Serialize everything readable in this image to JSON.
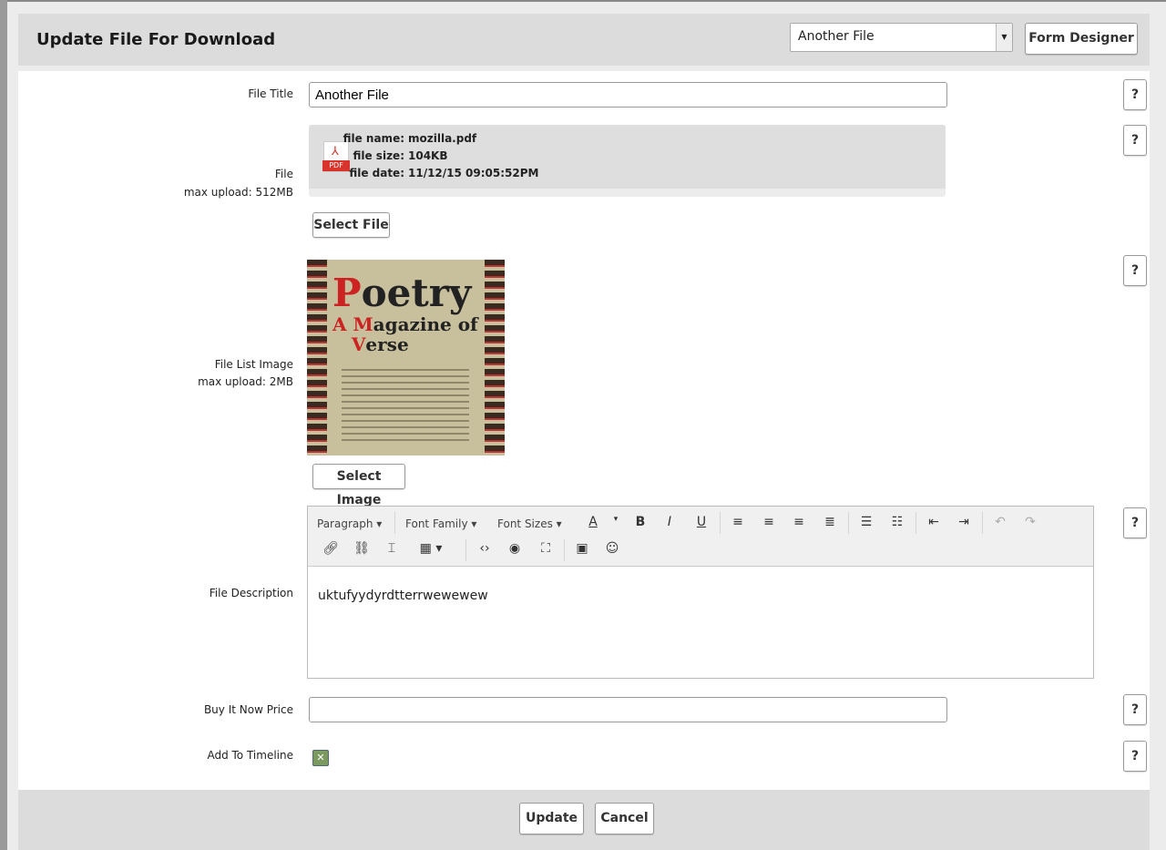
{
  "header": {
    "title": "Update File For Download",
    "file_select": "Another File",
    "form_designer": "Form Designer"
  },
  "fields": {
    "file_title": {
      "label": "File Title",
      "value": "Another File"
    },
    "file": {
      "label": "File",
      "sublabel": "max upload: 512MB",
      "name_key": "file name:",
      "name": "mozilla.pdf",
      "size_key": "file size:",
      "size": "104KB",
      "date_key": "file date:",
      "date": "11/12/15 09:05:52PM",
      "icon_text": "PDF",
      "select_button": "Select File"
    },
    "image": {
      "label": "File List Image",
      "sublabel": "max upload: 2MB",
      "select_button": "Select Image",
      "image_text": "Poetry A Magazine of Verse"
    },
    "description": {
      "label": "File Description",
      "value": "uktufyydyrdtterrwewewew",
      "toolbar": {
        "paragraph": "Paragraph",
        "font_family": "Font Family",
        "font_sizes": "Font Sizes"
      }
    },
    "price": {
      "label": "Buy It Now Price",
      "value": ""
    },
    "timeline": {
      "label": "Add To Timeline",
      "checked": true
    }
  },
  "help_label": "?",
  "footer": {
    "update": "Update",
    "cancel": "Cancel"
  }
}
